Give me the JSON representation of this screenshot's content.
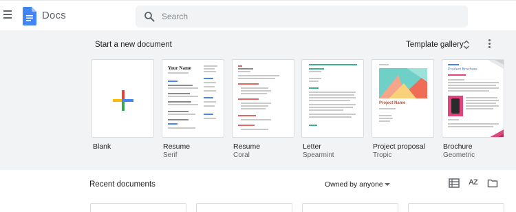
{
  "app": {
    "title": "Docs"
  },
  "search": {
    "placeholder": "Search",
    "value": ""
  },
  "templates": {
    "section_title": "Start a new document",
    "gallery_label": "Template gallery",
    "items": [
      {
        "name": "Blank",
        "sub": ""
      },
      {
        "name": "Resume",
        "sub": "Serif",
        "heading": "Your Name"
      },
      {
        "name": "Resume",
        "sub": "Coral"
      },
      {
        "name": "Letter",
        "sub": "Spearmint"
      },
      {
        "name": "Project proposal",
        "sub": "Tropic",
        "heading": "Project Name"
      },
      {
        "name": "Brochure",
        "sub": "Geometric",
        "heading": "Product Brochure"
      }
    ]
  },
  "recent": {
    "title": "Recent documents",
    "owner_filter": "Owned by anyone",
    "sort_label": "AZ"
  },
  "colors": {
    "accent_blue": "#4285f4",
    "google_red": "#ea4335",
    "google_yellow": "#fbbc04",
    "google_green": "#34a853",
    "spearmint": "#3cb08a",
    "tropic_teal": "#6fd0c7",
    "geometric_pink": "#e0447c"
  }
}
